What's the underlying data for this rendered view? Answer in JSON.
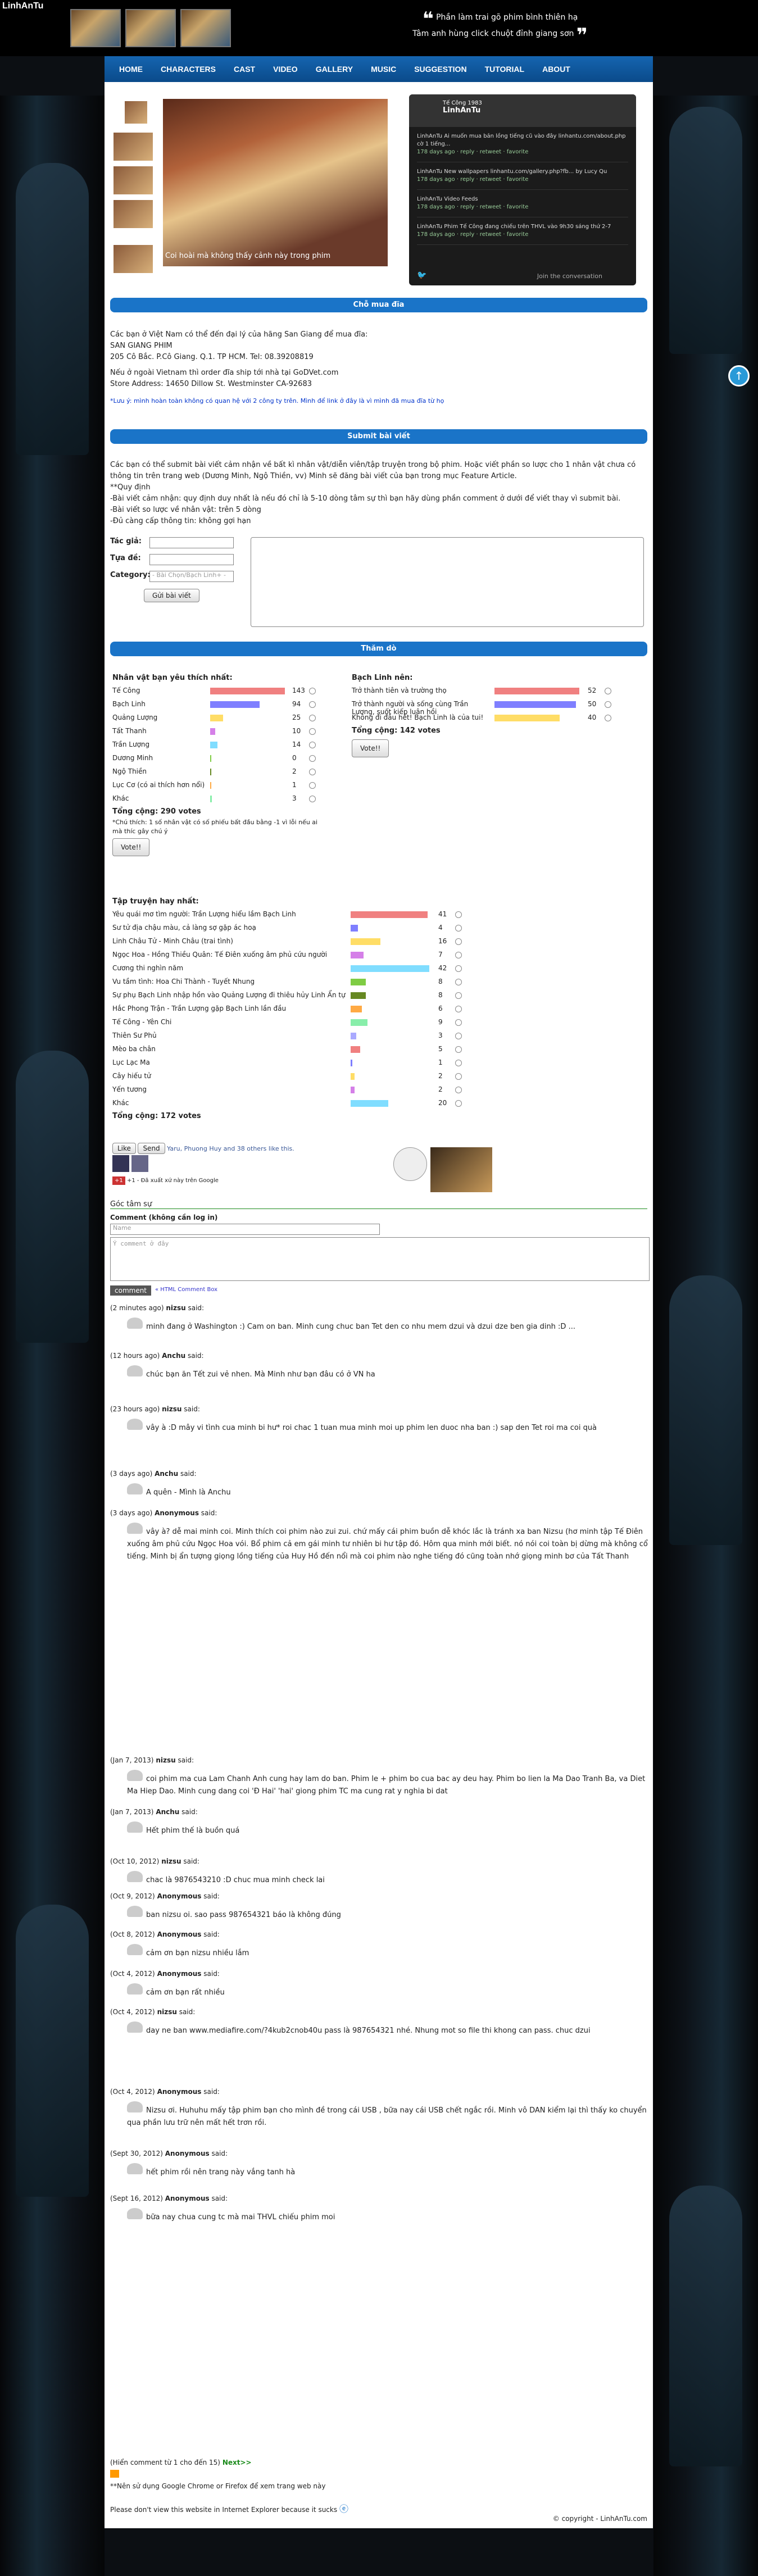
{
  "brand": "LinhAnTu",
  "quote": {
    "line1": "Phần làm trai gõ phim bình thiên hạ",
    "line2": "Tâm anh hùng click chuột đỉnh giang sơn"
  },
  "nav": [
    "HOME",
    "CHARACTERS",
    "CAST",
    "VIDEO",
    "GALLERY",
    "MUSIC",
    "SUGGESTION",
    "TUTORIAL",
    "ABOUT"
  ],
  "gallery": {
    "caption": "Coi hoài mà không thấy cảnh này trong phim"
  },
  "twitter": {
    "handle": "Tế Công 1983",
    "name": "LinhAnTu",
    "items": [
      "LinhAnTu Ai muốn mua bản lồng tiếng cũ vào đây linhantu.com/about.php cờ 1 tiếng...",
      "LinhAnTu New wallpapers linhantu.com/gallery.php?fb... by Lucy Qu",
      "LinhAnTu Video Feeds",
      "LinhAnTu Phim Tế Công đang chiếu trên THVL vào 9h30 sáng thứ 2-7"
    ],
    "meta": "178 days ago · reply · retweet · favorite",
    "footer": "Join the conversation"
  },
  "sections": {
    "buy": "Chỗ mua đĩa",
    "submit": "Submit bài viết",
    "poll": "Thăm dò"
  },
  "buy": {
    "p1": "Các bạn ở Việt Nam có thể đến đại lý của hãng San Giang để mua đĩa:",
    "p2": "SAN GIANG PHIM",
    "p3": "205 Cô Bắc. P.Cô Giang. Q.1. TP HCM. Tel: 08.39208819",
    "p4": "Nếu ở ngoài Vietnam thì order đĩa ship tới nhà tại GoDVet.com",
    "p5": "Store Address: 14650 Dillow St. Westminster CA-92683",
    "note": "*Lưu ý: mình hoàn toàn không có quan hệ với 2 công ty trên. Mình để link ở đây là vì mình đã mua đĩa từ họ"
  },
  "submit": {
    "p1": "Các bạn có thể submit bài viết cảm nhận về bất kì nhân vật/diễn viên/tập truyện trong bộ phim. Hoặc viết phần so lược cho 1 nhân vật chưa có thông tin trên trang web (Dương Minh, Ngộ Thiền, vv) Minh sẽ đăng bài viết của bạn trong mục Feature Article.",
    "p2": "**Quy định",
    "p3": "-Bài viết cảm nhận: quy định duy nhất là nếu đó chỉ là 5-10 dòng tâm sự thì bạn hãy dùng phần comment ở dưới để viết thay vì submit bài.",
    "p4": "-Bài viết so lược về nhân vật: trên 5 dòng",
    "p5": "-Đủ càng cấp thông tin: không gợi hạn",
    "author": "Tác giả:",
    "title": "Tựa đề:",
    "category": "Category:",
    "category_ph": "- Bài Chọn/Bạch Linh+ -",
    "send": "Gửi bài viết"
  },
  "poll1": {
    "title": "Nhân vật bạn yêu thích nhất:",
    "items": [
      [
        "Tế Công",
        143
      ],
      [
        "Bạch Linh",
        94
      ],
      [
        "Quảng Lượng",
        25
      ],
      [
        "Tất Thanh",
        10
      ],
      [
        "Trần Lượng",
        14
      ],
      [
        "Dương Minh",
        0
      ],
      [
        "Ngộ Thiền",
        2
      ],
      [
        "Lục Cơ (có ai thích hơn nổi)",
        1
      ],
      [
        "Khác",
        3
      ]
    ],
    "total": "Tổng cộng: 290 votes",
    "note": "*Chú thích: 1 số nhân vật có số phiếu bất đầu bằng -1 vì lỗi nếu ai mà thíc gây chú ý",
    "vote": "Vote!!"
  },
  "poll2": {
    "title": "Bạch Linh nên:",
    "items": [
      [
        "Trở thành tiên và trường thọ",
        52
      ],
      [
        "Trở thành người và sống cùng Trần Lương, suốt kiếp luân hồi",
        50
      ],
      [
        "Không đi đâu hết! Bạch Linh là của tui!",
        40
      ]
    ],
    "total": "Tổng cộng: 142 votes",
    "vote": "Vote!!"
  },
  "poll3": {
    "title": "Tập truyện hay nhất:",
    "items": [
      [
        "Yêu quái mơ tìm người: Trần Lượng hiểu lầm Bạch Linh",
        41
      ],
      [
        "Sư tử địa chậu màu, cả làng sợ gặp ác hoạ",
        4
      ],
      [
        "Linh Châu Tử - Minh Châu (trai tình)",
        16
      ],
      [
        "Ngọc Hoa - Hồng Thiều Quân: Tế Điên xuống âm phủ cứu người",
        7
      ],
      [
        "Cương thi nghìn năm",
        42
      ],
      [
        "Vu tầm tình: Hoa Chi Thành - Tuyết Nhung",
        8
      ],
      [
        "Sự phụ Bạch Linh nhập hồn vào Quảng Lượng đi thiêu hủy Linh Ẩn tự",
        8
      ],
      [
        "Hắc Phong Trận - Trần Lượng gặp Bạch Linh lần đầu",
        6
      ],
      [
        "Tế Công - Yên Chi",
        9
      ],
      [
        "Thiên Sư Phủ",
        3
      ],
      [
        "Mèo ba chân",
        5
      ],
      [
        "Lục Lạc Ma",
        1
      ],
      [
        "Cây hiếu tử",
        2
      ],
      [
        "Yến tương",
        2
      ],
      [
        "Khác",
        20
      ]
    ],
    "total": "Tổng cộng: 172 votes",
    "vote": "Vote!!"
  },
  "social": {
    "like": "Like",
    "send": "Send",
    "likers": "Yaru, Phuong Huy and 38 others like this.",
    "gplus": "+1",
    "gnote": "+1 - Đã xuất xứ này trên Google"
  },
  "comments": {
    "header": "Góc tâm sự",
    "label": "Comment (không cần log in)",
    "name_ph": "Name",
    "text_ph": "Ý comment ở đây",
    "btn": "comment",
    "help": "« HTML Comment Box",
    "list": [
      {
        "meta": "(2 minutes ago)",
        "author": "nizsu",
        "text": "minh đang ở Washington :) Cam on ban. Minh cung chuc ban Tet den co nhu mem dzui và dzui dze ben gia dinh :D ..."
      },
      {
        "meta": "(12 hours ago)",
        "author": "Anchu",
        "text": "chúc bạn ăn Tết zui vẻ nhen. Mà Minh như bạn đâu có ở VN ha"
      },
      {
        "meta": "(23 hours ago)",
        "author": "nizsu",
        "text": "vây à :D mây vi tình cua minh bi hư* roi chac 1 tuan mua minh moi up phim len duoc nha ban :) sap den Tet roi ma coi quà"
      },
      {
        "meta": "(3 days ago)",
        "author": "Anchu",
        "text": "A quên - Mình là Anchu"
      },
      {
        "meta": "(3 days ago)",
        "author": "Anonymous",
        "text": "vây à? dễ mai minh coi. Minh thích coi phim nào zui zui. chứ mấy cái phim buồn dễ khóc lắc là tránh xa ban Nizsu (hơ minh tập Tế Điên xuống âm phủ cứu Ngọc Hoa vói. Bổ phim cả em gái minh tư nhiên bi hư tập đó. Hôm qua minh mới biết. nó nói coi toàn bị dừng mà không cổ tiếng. Minh bị ẩn tượng giọng lồng tiếng của Huy Hồ đến nổi mà coi phim nào nghe tiếng đó cũng toàn nhớ giọng minh bơ của Tất Thanh"
      },
      {
        "meta": "(Jan 7, 2013)",
        "author": "nizsu",
        "text": "coi phim ma cua Lam Chanh Anh cung hay lam do ban. Phim le + phim bo cua bac ay deu hay. Phim bo lien la Ma Dao Tranh Ba, va Diet Ma Hiep Dao. Minh cung dang coi 'Đ Hai' 'hai' giong phim TC ma cung rat y nghia bi dat"
      },
      {
        "meta": "(Jan 7, 2013)",
        "author": "Anchu",
        "text": "Hết phim thế là buồn quá"
      },
      {
        "meta": "(Oct 10, 2012)",
        "author": "nizsu",
        "text": "chac là 9876543210 :D chuc mua minh check lai"
      },
      {
        "meta": "(Oct 9, 2012)",
        "author": "Anonymous",
        "text": "ban nizsu oi. sao pass 987654321 báo là không đúng"
      },
      {
        "meta": "(Oct 8, 2012)",
        "author": "Anonymous",
        "text": "cảm ơn bạn nizsu nhiều lắm"
      },
      {
        "meta": "(Oct 4, 2012)",
        "author": "Anonymous",
        "text": "cảm ơn bạn rất nhiều"
      },
      {
        "meta": "(Oct 4, 2012)",
        "author": "nizsu",
        "text": "day ne ban www.mediafire.com/?4kub2cnob40u pass là 987654321 nhé. Nhung mot so file thi khong can pass. chuc dzui"
      },
      {
        "meta": "(Oct 4, 2012)",
        "author": "Anonymous",
        "text": "Nizsu ơi. Huhuhu mấy tập phim bạn cho mình đề trong cái USB , bữa nay cái USB chết ngắc rồi. Minh vô DAN kiểm lại thì thấy ko chuyển qua phần lưu trữ nên mất hết trơn rồi."
      },
      {
        "meta": "(Sept 30, 2012)",
        "author": "Anonymous",
        "text": "hết phim rồi nên trang này vắng tanh hà"
      },
      {
        "meta": "(Sept 16, 2012)",
        "author": "Anonymous",
        "text": "bữa nay chua cung tc mà mai THVL chiếu phim moi"
      }
    ],
    "pager": "(Hiển comment từ 1 cho đến 15)",
    "next": "Next>>"
  },
  "footer": {
    "browser": "**Nên sử dụng Google Chrome or Firefox để xem trang web này",
    "ie": "Please don't view this website in Internet Explorer because it sucks",
    "copy": "© copyright - LinhAnTu.com"
  }
}
